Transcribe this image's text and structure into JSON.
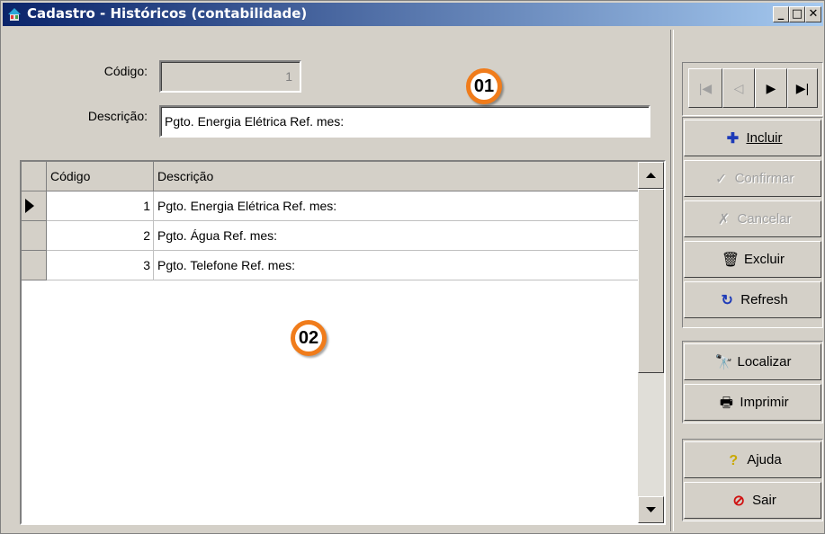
{
  "window": {
    "title": "Cadastro - Históricos (contabilidade)",
    "controls": {
      "minimize": "_",
      "maximize": "□",
      "close": "✕"
    }
  },
  "form": {
    "codigo_label": "Código:",
    "codigo_value": "1",
    "descricao_label": "Descrição:",
    "descricao_value": "Pgto. Energia Elétrica Ref. mes:"
  },
  "grid": {
    "headers": [
      "Código",
      "Descrição"
    ],
    "rows": [
      {
        "codigo": "1",
        "descricao": "Pgto. Energia Elétrica Ref. mes:"
      },
      {
        "codigo": "2",
        "descricao": "Pgto. Água Ref. mes:"
      },
      {
        "codigo": "3",
        "descricao": "Pgto. Telefone Ref. mes:"
      }
    ]
  },
  "callouts": [
    "01",
    "02"
  ],
  "navigator": {
    "first": "|◀",
    "prior": "◁",
    "next": "▶",
    "last": "▶|"
  },
  "buttons": {
    "incluir": "Incluir",
    "confirmar": "Confirmar",
    "cancelar": "Cancelar",
    "excluir": "Excluir",
    "refresh": "Refresh",
    "localizar": "Localizar",
    "imprimir": "Imprimir",
    "ajuda": "Ajuda",
    "sair": "Sair"
  },
  "colors": {
    "face": "#d4d0c8",
    "title_start": "#0a246a",
    "title_end": "#a6caf0",
    "callout": "#f07c1b"
  }
}
